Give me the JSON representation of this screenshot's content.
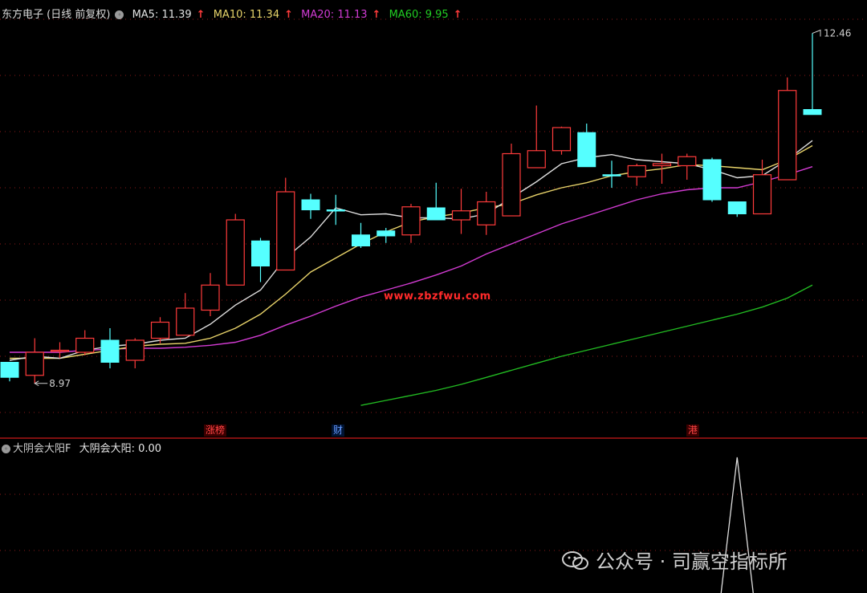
{
  "header": {
    "title": "东方电子 (日线 前复权)",
    "ma5": "MA5: 11.39",
    "ma10": "MA10: 11.34",
    "ma20": "MA20: 11.13",
    "ma60": "MA60: 9.95",
    "arrow": "↑"
  },
  "sub_panel": {
    "name": "大阴会大阳F",
    "value_label": "大阴会大阳: 0.00"
  },
  "tags": [
    "涨榜",
    "财",
    "港"
  ],
  "watermark_site": "www.zbzfwu.com",
  "watermark_account": "公众号 · 司赢空指标所",
  "colors": {
    "up": "#ff3b3b",
    "down": "#55ffff",
    "ma5": "#dddddd",
    "ma10": "#e8d36a",
    "ma20": "#d33bd3",
    "ma60": "#22bb22",
    "grid": "#8b1a1a",
    "tag_red": "#ff4444",
    "tag_blue": "#6699ff"
  },
  "chart_data": {
    "type": "candlestick",
    "ylim": [
      8.6,
      12.6
    ],
    "high_label": "12.46",
    "low_label": "8.97",
    "candles": [
      {
        "o": 9.18,
        "h": 9.18,
        "l": 8.99,
        "c": 9.03
      },
      {
        "o": 9.05,
        "h": 9.42,
        "l": 8.97,
        "c": 9.28
      },
      {
        "o": 9.3,
        "h": 9.38,
        "l": 9.22,
        "c": 9.3
      },
      {
        "o": 9.28,
        "h": 9.5,
        "l": 9.25,
        "c": 9.42
      },
      {
        "o": 9.4,
        "h": 9.52,
        "l": 9.12,
        "c": 9.18
      },
      {
        "o": 9.2,
        "h": 9.42,
        "l": 9.12,
        "c": 9.4
      },
      {
        "o": 9.42,
        "h": 9.63,
        "l": 9.37,
        "c": 9.58
      },
      {
        "o": 9.45,
        "h": 9.87,
        "l": 9.45,
        "c": 9.72
      },
      {
        "o": 9.7,
        "h": 10.07,
        "l": 9.64,
        "c": 9.95
      },
      {
        "o": 9.95,
        "h": 10.66,
        "l": 9.95,
        "c": 10.6
      },
      {
        "o": 10.39,
        "h": 10.42,
        "l": 9.98,
        "c": 10.14
      },
      {
        "o": 10.1,
        "h": 11.02,
        "l": 10.1,
        "c": 10.88
      },
      {
        "o": 10.8,
        "h": 10.86,
        "l": 10.61,
        "c": 10.7
      },
      {
        "o": 10.7,
        "h": 10.85,
        "l": 10.55,
        "c": 10.69
      },
      {
        "o": 10.45,
        "h": 10.57,
        "l": 10.32,
        "c": 10.34
      },
      {
        "o": 10.49,
        "h": 10.52,
        "l": 10.37,
        "c": 10.44
      },
      {
        "o": 10.45,
        "h": 10.76,
        "l": 10.37,
        "c": 10.73
      },
      {
        "o": 10.72,
        "h": 10.97,
        "l": 10.62,
        "c": 10.6
      },
      {
        "o": 10.6,
        "h": 10.91,
        "l": 10.46,
        "c": 10.69
      },
      {
        "o": 10.55,
        "h": 10.88,
        "l": 10.45,
        "c": 10.78
      },
      {
        "o": 10.64,
        "h": 11.36,
        "l": 10.64,
        "c": 11.26
      },
      {
        "o": 11.12,
        "h": 11.74,
        "l": 11.12,
        "c": 11.29
      },
      {
        "o": 11.29,
        "h": 11.53,
        "l": 11.25,
        "c": 11.52
      },
      {
        "o": 11.47,
        "h": 11.56,
        "l": 11.13,
        "c": 11.13
      },
      {
        "o": 11.05,
        "h": 11.19,
        "l": 10.92,
        "c": 11.04
      },
      {
        "o": 11.03,
        "h": 11.16,
        "l": 10.94,
        "c": 11.14
      },
      {
        "o": 11.14,
        "h": 11.26,
        "l": 10.96,
        "c": 11.16
      },
      {
        "o": 11.14,
        "h": 11.26,
        "l": 11.0,
        "c": 11.23
      },
      {
        "o": 11.2,
        "h": 11.22,
        "l": 10.78,
        "c": 10.8
      },
      {
        "o": 10.78,
        "h": 10.78,
        "l": 10.63,
        "c": 10.66
      },
      {
        "o": 10.66,
        "h": 11.2,
        "l": 10.66,
        "c": 11.05
      },
      {
        "o": 11.0,
        "h": 12.02,
        "l": 11.0,
        "c": 11.89
      },
      {
        "o": 11.7,
        "h": 12.46,
        "l": 11.66,
        "c": 11.65
      }
    ],
    "ma5": [
      9.2,
      9.24,
      9.22,
      9.3,
      9.34,
      9.36,
      9.4,
      9.42,
      9.56,
      9.75,
      9.9,
      10.22,
      10.43,
      10.72,
      10.65,
      10.66,
      10.62,
      10.62,
      10.61,
      10.66,
      10.82,
      10.98,
      11.16,
      11.22,
      11.25,
      11.2,
      11.18,
      11.16,
      11.1,
      11.02,
      11.04,
      11.2,
      11.39
    ],
    "ma10": [
      9.22,
      9.22,
      9.22,
      9.26,
      9.3,
      9.34,
      9.36,
      9.37,
      9.42,
      9.52,
      9.66,
      9.86,
      10.08,
      10.22,
      10.36,
      10.48,
      10.58,
      10.63,
      10.67,
      10.72,
      10.76,
      10.85,
      10.92,
      10.97,
      11.04,
      11.08,
      11.11,
      11.15,
      11.14,
      11.12,
      11.1,
      11.2,
      11.34
    ],
    "ma20": [
      9.28,
      9.28,
      9.28,
      9.3,
      9.31,
      9.32,
      9.32,
      9.33,
      9.35,
      9.38,
      9.45,
      9.55,
      9.64,
      9.74,
      9.83,
      9.9,
      9.97,
      10.05,
      10.14,
      10.26,
      10.36,
      10.46,
      10.56,
      10.64,
      10.72,
      10.8,
      10.86,
      10.9,
      10.92,
      10.92,
      10.98,
      11.05,
      11.13
    ],
    "ma60": [
      null,
      null,
      null,
      null,
      null,
      null,
      null,
      null,
      null,
      null,
      null,
      null,
      null,
      null,
      8.75,
      8.8,
      8.85,
      8.9,
      8.96,
      9.03,
      9.1,
      9.17,
      9.24,
      9.3,
      9.36,
      9.42,
      9.48,
      9.54,
      9.6,
      9.66,
      9.73,
      9.82,
      9.95
    ],
    "indicator": [
      0,
      0,
      0,
      0,
      0,
      0,
      0,
      0,
      0,
      0,
      0,
      0,
      0,
      0,
      0,
      0,
      0,
      0,
      0,
      0,
      0,
      0,
      0,
      0,
      0,
      0,
      0,
      0,
      0,
      1,
      0,
      0,
      0
    ],
    "tag_at": [
      8,
      13,
      27
    ]
  }
}
